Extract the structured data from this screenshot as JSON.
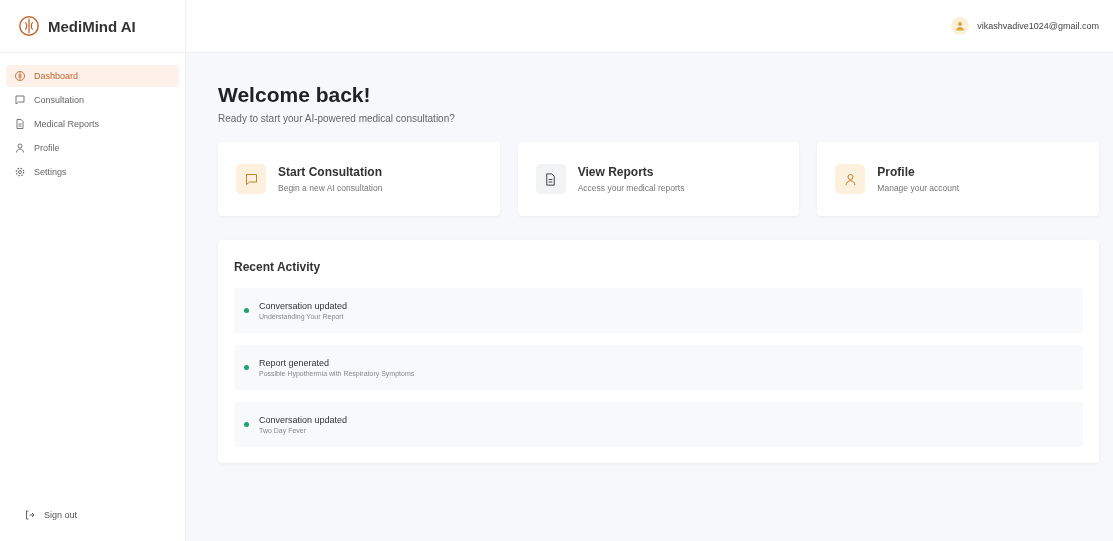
{
  "brand": {
    "name": "MediMind AI"
  },
  "sidebar": {
    "items": [
      {
        "label": "Dashboard",
        "kind": "brain",
        "selected": true
      },
      {
        "label": "Consultation",
        "kind": "chat",
        "selected": false
      },
      {
        "label": "Medical Reports",
        "kind": "document",
        "selected": false
      },
      {
        "label": "Profile",
        "kind": "person",
        "selected": false
      },
      {
        "label": "Settings",
        "kind": "gear",
        "selected": false
      }
    ],
    "sign_out": "Sign out"
  },
  "header": {
    "user_email": "vikashvadive1024@gmail.com"
  },
  "welcome": {
    "title": "Welcome back!",
    "subtitle": "Ready to start your AI-powered medical consultation?"
  },
  "cards": [
    {
      "title": "Start Consultation",
      "description": "Begin a new AI consultation",
      "kind": "chat"
    },
    {
      "title": "View Reports",
      "description": "Access your medical reports",
      "kind": "document"
    },
    {
      "title": "Profile",
      "description": "Manage your account",
      "kind": "person"
    }
  ],
  "recent_activity": {
    "title": "Recent Activity",
    "items": [
      {
        "title": "Conversation updated",
        "detail": "Understanding Your Report",
        "color": "#22a06b"
      },
      {
        "title": "Report generated",
        "detail": "Possible Hypothermia with Respiratory Symptoms",
        "color": "#22a06b"
      },
      {
        "title": "Conversation updated",
        "detail": "Two Day Fever",
        "color": "#22a06b"
      }
    ]
  }
}
